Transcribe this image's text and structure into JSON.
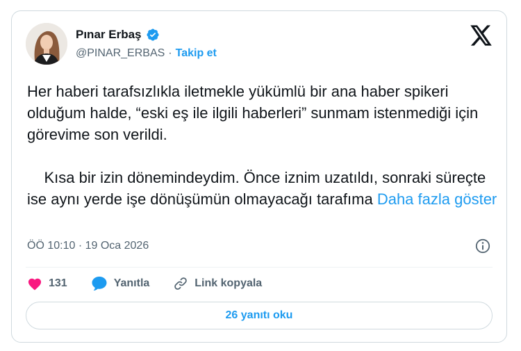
{
  "author": {
    "display_name": "Pınar Erbaş",
    "handle": "@PINAR_ERBAS",
    "separator": "·",
    "follow_label": "Takip et",
    "verified": true
  },
  "tweet": {
    "paragraph1": "Her haberi tarafsızlıkla iletmekle yükümlü bir ana haber spikeri olduğum halde, “eski eş ile ilgili haberleri” sunmam istenmediği için görevime son verildi.",
    "paragraph2": "    Kısa bir izin dönemindeydim. Önce iznim uzatıldı, sonraki süreçte ise aynı yerde işe dönüşümün olmayacağı tarafıma ",
    "show_more_label": "Daha fazla göster",
    "timestamp": "ÖÖ 10:10 · 19 Oca 2026"
  },
  "actions": {
    "like_count": "131",
    "reply_label": "Yanıtla",
    "copy_link_label": "Link kopyala"
  },
  "read_replies_label": "26 yanıtı oku",
  "colors": {
    "accent": "#1d9bf0",
    "like": "#f91880",
    "text": "#0f1419",
    "secondary": "#536471",
    "border": "#cfd9de"
  },
  "icons": [
    "verified-badge-icon",
    "x-logo-icon",
    "info-icon",
    "heart-icon",
    "reply-bubble-icon",
    "link-icon"
  ]
}
